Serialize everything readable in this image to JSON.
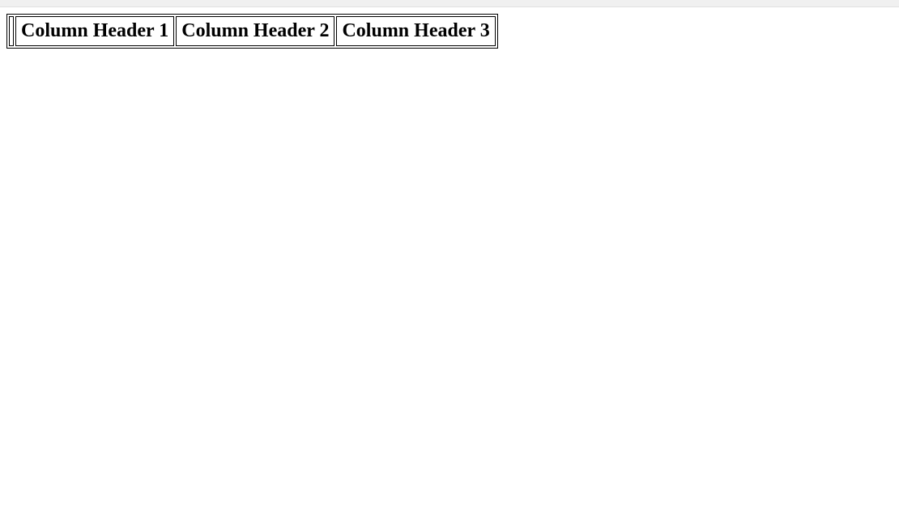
{
  "table": {
    "headers": [
      "",
      "Column Header 1",
      "Column Header 2",
      "Column Header 3"
    ]
  }
}
